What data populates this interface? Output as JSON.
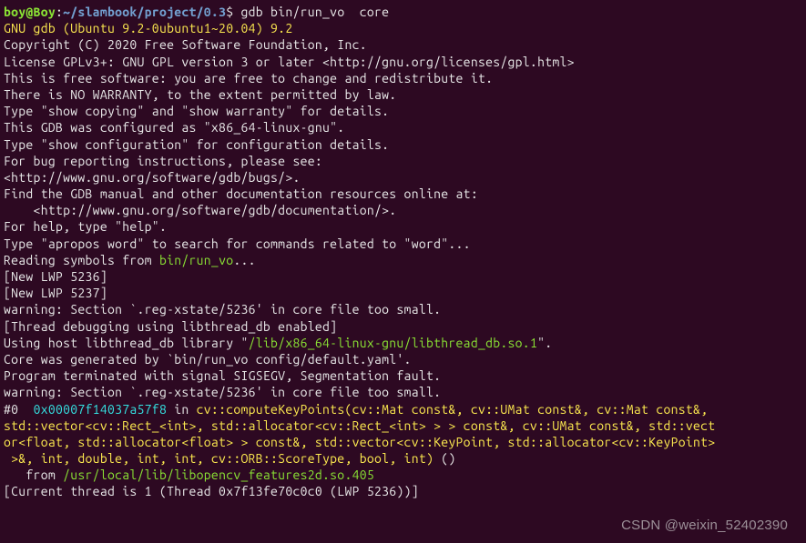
{
  "prompt": {
    "user": "boy@Boy",
    "sep": ":",
    "path": "~/slambook/project/0.3",
    "dollar": "$ ",
    "cmd": "gdb bin/run_vo  core"
  },
  "version_line": "GNU gdb (Ubuntu 9.2-0ubuntu1~20.04) 9.2",
  "intro": [
    "Copyright (C) 2020 Free Software Foundation, Inc.",
    "License GPLv3+: GNU GPL version 3 or later <http://gnu.org/licenses/gpl.html>",
    "This is free software: you are free to change and redistribute it.",
    "There is NO WARRANTY, to the extent permitted by law.",
    "Type \"show copying\" and \"show warranty\" for details.",
    "This GDB was configured as \"x86_64-linux-gnu\".",
    "Type \"show configuration\" for configuration details.",
    "For bug reporting instructions, please see:",
    "<http://www.gnu.org/software/gdb/bugs/>.",
    "Find the GDB manual and other documentation resources online at:",
    "    <http://www.gnu.org/software/gdb/documentation/>.",
    "",
    "For help, type \"help\".",
    "Type \"apropos word\" to search for commands related to \"word\"..."
  ],
  "reading_symbols": {
    "pre": "Reading symbols from ",
    "path": "bin/run_vo",
    "post": "..."
  },
  "lwp": [
    "[New LWP 5236]",
    "[New LWP 5237]",
    ""
  ],
  "warn1": "warning: Section `.reg-xstate/5236' in core file too small.",
  "thread_dbg": "[Thread debugging using libthread_db enabled]",
  "host_lib": {
    "pre": "Using host libthread_db library \"",
    "path": "/lib/x86_64-linux-gnu/libthread_db.so.1",
    "post": "\"."
  },
  "core_gen": "Core was generated by `bin/run_vo config/default.yaml'.",
  "term": "Program terminated with signal SIGSEGV, Segmentation fault.",
  "blank": "",
  "warn2": "warning: Section `.reg-xstate/5236' in core file too small.",
  "frame": {
    "num": "#0  ",
    "addr": "0x00007f14037a57f8",
    "in": " in ",
    "sig1": "cv::computeKeyPoints(cv::Mat const&, cv::UMat const&, cv::Mat const&, ",
    "sig2": "std::vector<cv::Rect_<int>, std::allocator<cv::Rect_<int> > > const&, cv::UMat const&, std::vect",
    "sig3": "or<float, std::allocator<float> > const&, std::vector<cv::KeyPoint, std::allocator<cv::KeyPoint>",
    "sig4": " >&, int, double, int, int, cv::ORB::ScoreType, bool, int)",
    "paren": " ()",
    "from_indent": "   from ",
    "from_path": "/usr/local/lib/libopencv_features2d.so.405"
  },
  "current_thread": "[Current thread is 1 (Thread 0x7f13fe70c0c0 (LWP 5236))]",
  "watermark": "CSDN @weixin_52402390"
}
